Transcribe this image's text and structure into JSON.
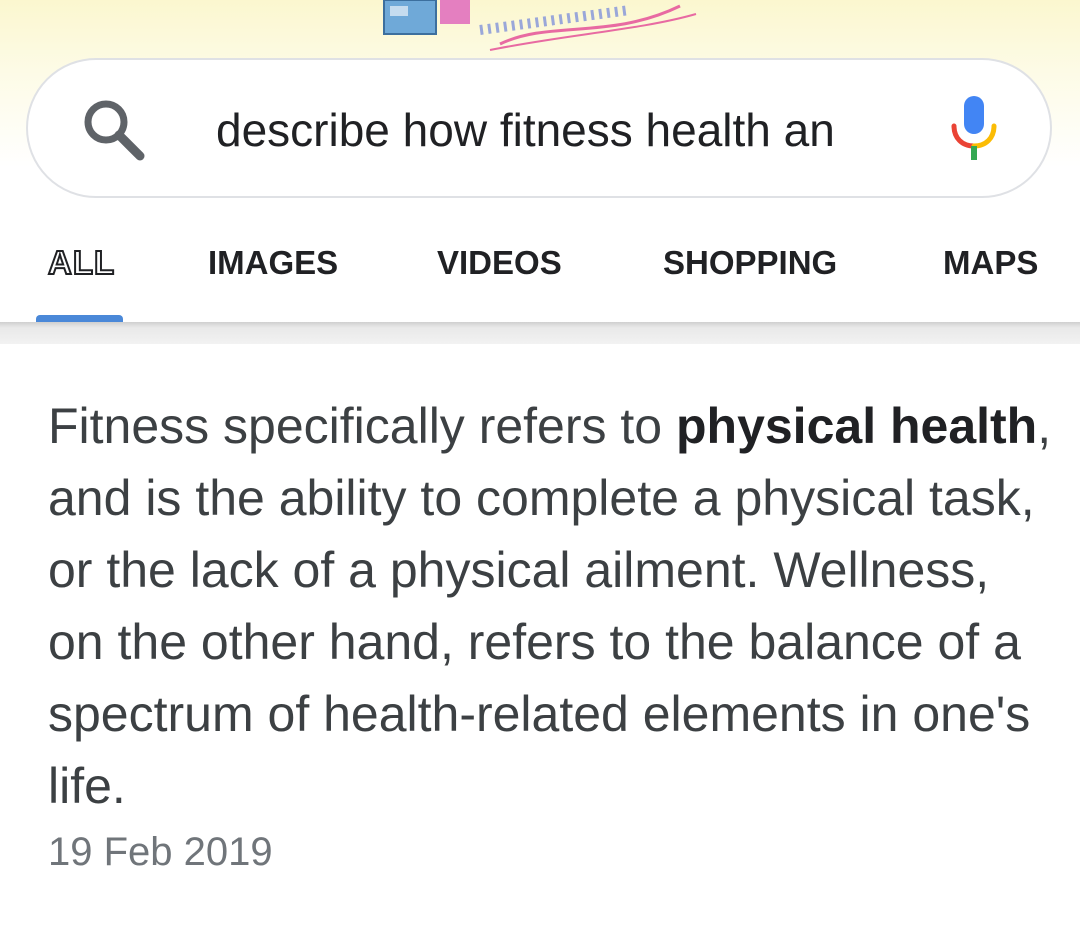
{
  "search": {
    "query": "describe how fitness health an"
  },
  "tabs": [
    {
      "label": "ALL",
      "active": true
    },
    {
      "label": "IMAGES"
    },
    {
      "label": "VIDEOS"
    },
    {
      "label": "SHOPPING"
    },
    {
      "label": "MAPS"
    }
  ],
  "result": {
    "segments": [
      {
        "text": "Fitness specifically refers to ",
        "bold": false
      },
      {
        "text": "physical health",
        "bold": true
      },
      {
        "text": ", and is the ability to complete a physical task, or the lack of a physical ailment. Wellness, on the other hand, refers to the balance of a spectrum of health-related elements in one's life.",
        "bold": false
      }
    ],
    "date": "19 Feb 2019"
  },
  "colors": {
    "accent": "#4a88d8",
    "text": "#3c4043",
    "muted": "#70757a"
  },
  "icons": {
    "search": "search-icon",
    "mic": "microphone-icon"
  }
}
